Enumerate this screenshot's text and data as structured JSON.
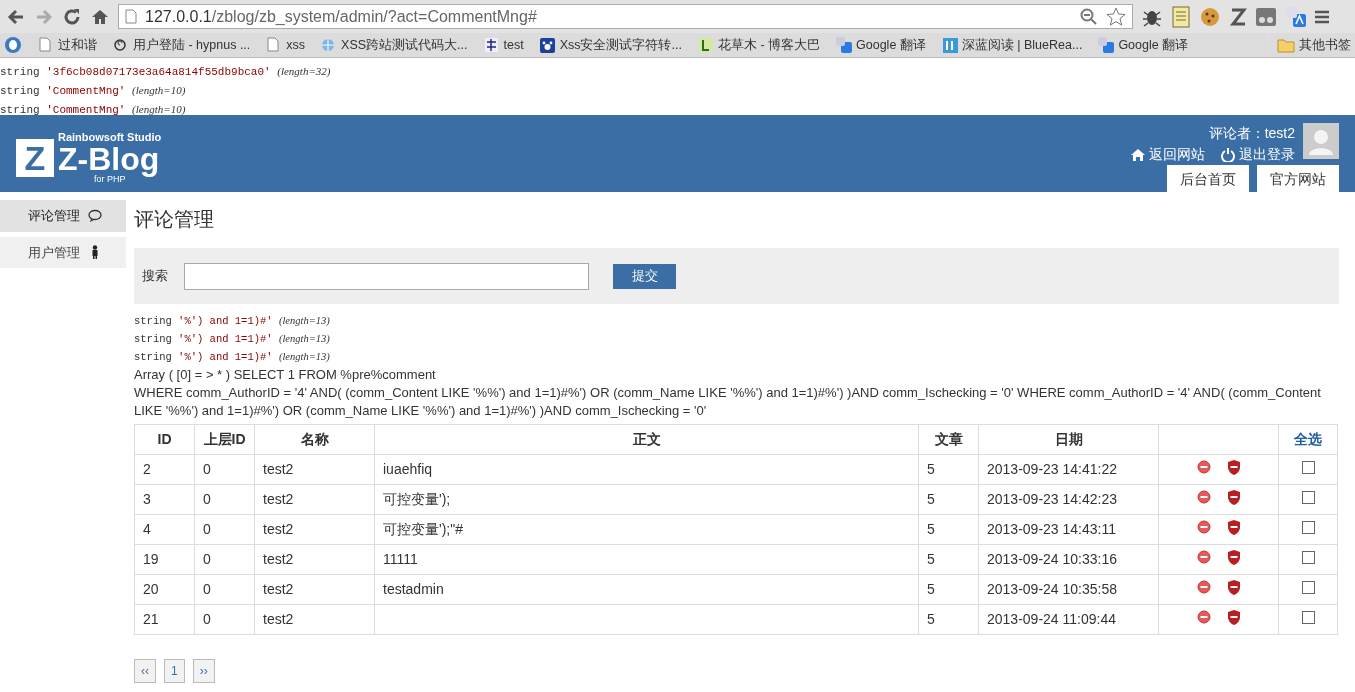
{
  "browser": {
    "url": {
      "host": "127.0.0.1",
      "path": "/zblog/zb_system/admin/?act=CommentMng#"
    },
    "bookmarks": [
      {
        "label": "过和谐",
        "kind": "page"
      },
      {
        "label": "用户登陆 - hypnus ...",
        "kind": "swirl"
      },
      {
        "label": "xss",
        "kind": "page"
      },
      {
        "label": "XSS跨站测试代码大...",
        "kind": "globe"
      },
      {
        "label": "test",
        "kind": "grass"
      },
      {
        "label": "Xss安全测试字符转...",
        "kind": "paw"
      },
      {
        "label": "花草木 - 博客大巴",
        "kind": "leaf"
      },
      {
        "label": "Google 翻译",
        "kind": "translate"
      },
      {
        "label": "深蓝阅读 | BlueRea...",
        "kind": "book"
      },
      {
        "label": "Google 翻译",
        "kind": "translate"
      }
    ],
    "other_bookmarks": "其他书签"
  },
  "debug_top": [
    {
      "type": "string",
      "value": "'3f6cb08d07173e3a64a814f55db9bca0'",
      "length": "(length=32)"
    },
    {
      "type": "string",
      "value": "'CommentMng'",
      "length": "(length=10)"
    },
    {
      "type": "string",
      "value": "'CommentMng'",
      "length": "(length=10)"
    }
  ],
  "header": {
    "logo": {
      "studio": "Rainbowsoft Studio",
      "letter": "Z",
      "name": "Z-Blog",
      "sub": "for PHP"
    },
    "user": "评论者：test2",
    "links": [
      {
        "label": "返回网站",
        "kind": "home"
      },
      {
        "label": "退出登录",
        "kind": "power"
      }
    ],
    "tabs": [
      "后台首页",
      "官方网站"
    ]
  },
  "sidebar": {
    "items": [
      {
        "label": "评论管理",
        "kind": "comment",
        "selected": true
      },
      {
        "label": "用户管理",
        "kind": "user",
        "selected": false
      }
    ]
  },
  "main": {
    "title": "评论管理",
    "search": {
      "label": "搜索",
      "button": "提交"
    },
    "debug": [
      {
        "type": "string",
        "value": "'%') and 1=1)#'",
        "length": "(length=13)"
      },
      {
        "type": "string",
        "value": "'%') and 1=1)#'",
        "length": "(length=13)"
      },
      {
        "type": "string",
        "value": "'%') and 1=1)#'",
        "length": "(length=13)"
      }
    ],
    "sql_line_1": "Array ( [0] = > * ) SELECT 1 FROM %pre%comment",
    "sql_line_2": "WHERE comm_AuthorID = '4' AND( (comm_Content LIKE '%%') and 1=1)#%') OR (comm_Name LIKE '%%') and 1=1)#%') )AND comm_Ischecking = '0' WHERE comm_AuthorID = '4' AND( (comm_Content LIKE '%%') and 1=1)#%') OR (comm_Name LIKE '%%') and 1=1)#%') )AND comm_Ischecking = '0'",
    "table": {
      "columns": [
        "ID",
        "上层ID",
        "名称",
        "正文",
        "文章",
        "日期"
      ],
      "select_all": "全选",
      "rows": [
        {
          "id": "2",
          "parent": "0",
          "name": "test2",
          "content": "iuaehfiq",
          "article": "5",
          "date": "2013-09-23 14:41:22",
          "checked": false
        },
        {
          "id": "3",
          "parent": "0",
          "name": "test2",
          "content": "可控变量');",
          "article": "5",
          "date": "2013-09-23 14:42:23",
          "checked": false
        },
        {
          "id": "4",
          "parent": "0",
          "name": "test2",
          "content": "可控变量');\"#",
          "article": "5",
          "date": "2013-09-23 14:43:11",
          "checked": false
        },
        {
          "id": "19",
          "parent": "0",
          "name": "test2",
          "content": "11111",
          "article": "5",
          "date": "2013-09-24 10:33:16",
          "checked": false
        },
        {
          "id": "20",
          "parent": "0",
          "name": "test2",
          "content": "testadmin",
          "article": "5",
          "date": "2013-09-24 10:35:58",
          "checked": false
        },
        {
          "id": "21",
          "parent": "0",
          "name": "test2",
          "content": "",
          "article": "5",
          "date": "2013-09-24 11:09:44",
          "checked": false
        }
      ]
    },
    "pager": [
      "‹‹",
      "1",
      "››"
    ]
  }
}
